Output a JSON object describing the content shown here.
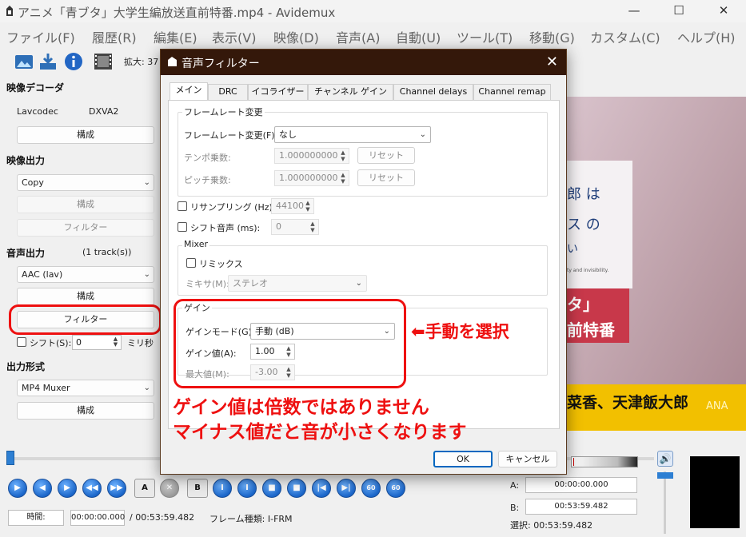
{
  "window": {
    "title": "アニメ「青ブタ」大学生編放送直前特番.mp4 - Avidemux",
    "minimize": "—",
    "maximize": "☐",
    "close": "✕"
  },
  "menu": [
    "ファイル(F)",
    "履歴(R)",
    "編集(E)",
    "表示(V)",
    "映像(D)",
    "音声(A)",
    "自動(U)",
    "ツール(T)",
    "移動(G)",
    "カスタム(C)",
    "ヘルプ(H)"
  ],
  "toolbar": {
    "zoom_label": "拡大: 37"
  },
  "left": {
    "video_decoder": {
      "title": "映像デコーダ",
      "codec": "Lavcodec",
      "hw": "DXVA2",
      "config": "構成"
    },
    "video_output": {
      "title": "映像出力",
      "codec": "Copy",
      "config": "構成",
      "filters": "フィルター"
    },
    "audio_output": {
      "title": "音声出力",
      "tracks": "(1 track(s))",
      "codec": "AAC (lav)",
      "config": "構成",
      "filters": "フィルター",
      "shift_label": "シフト(S):",
      "shift_value": "0",
      "shift_unit": "ミリ秒"
    },
    "output_format": {
      "title": "出力形式",
      "muxer": "MP4 Muxer",
      "config": "構成"
    }
  },
  "preview": {
    "line1": "郎 は",
    "line2": "ス の",
    "line3": "い",
    "small": "ty and invisibility.",
    "banner1": "タ」",
    "banner2": "前特番",
    "bottom": "菜香、天津飯大郎",
    "watermark": "ANA"
  },
  "bottom": {
    "time_label": "時間:",
    "current_time": "00:00:00.000",
    "total_time": "/ 00:53:59.482",
    "frame_type": "フレーム種類: I-FRM",
    "a_label": "A:",
    "a_value": "00:00:00.000",
    "b_label": "B:",
    "b_value": "00:53:59.482",
    "selection": "選択: 00:53:59.482"
  },
  "dialog": {
    "title": "音声フィルター",
    "close": "✕",
    "tabs": [
      "メイン",
      "DRC",
      "イコライザー",
      "チャンネル ゲイン",
      "Channel delays",
      "Channel remap"
    ],
    "framerate": {
      "group": "フレームレート変更",
      "change_label": "フレームレート変更(F):",
      "change_value": "なし",
      "tempo_label": "テンポ乗数:",
      "tempo_value": "1.000000000",
      "tempo_reset": "リセット",
      "pitch_label": "ピッチ乗数:",
      "pitch_value": "1.000000000",
      "pitch_reset": "リセット"
    },
    "resample_label": "リサンプリング (Hz):",
    "resample_value": "44100",
    "shift_label": "シフト音声 (ms):",
    "shift_value": "0",
    "mixer": {
      "group": "Mixer",
      "remix_label": "リミックス",
      "mixer_label": "ミキサ(M):",
      "mixer_value": "ステレオ"
    },
    "gain": {
      "group": "ゲイン",
      "mode_label": "ゲインモード(G):",
      "mode_value": "手動 (dB)",
      "value_label": "ゲイン値(A):",
      "value": "1.00",
      "max_label": "最大値(M):",
      "max_value": "-3.00"
    },
    "ok": "OK",
    "cancel": "キャンセル"
  },
  "annotations": {
    "select_manual": "⬅手動を選択",
    "note1": "ゲイン値は倍数ではありません",
    "note2": "マイナス値だと音が小さくなります"
  },
  "colors": {
    "accent_red": "#ee1010",
    "dialog_title_bg": "#34180a"
  }
}
